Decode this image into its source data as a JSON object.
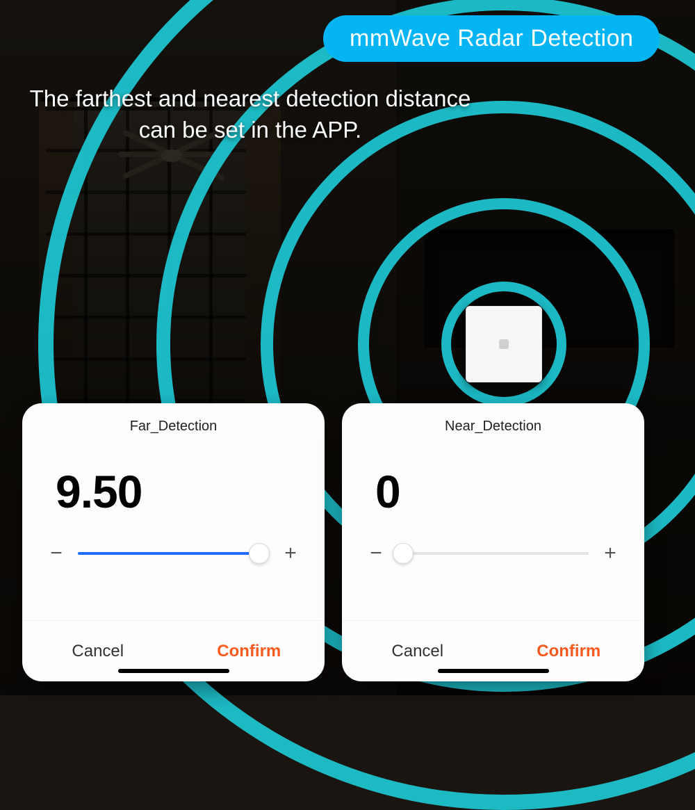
{
  "badge": "mmWave Radar Detection",
  "headline": "The farthest and nearest detection distance can be set in the APP.",
  "colors": {
    "accent": "#05B4F3",
    "ring": "#1EC3CF",
    "slider": "#1f6ef7",
    "confirm": "#f55a1e"
  },
  "cards": {
    "far": {
      "title": "Far_Detection",
      "value": "9.50",
      "slider_pct": 95,
      "minus": "−",
      "plus": "+",
      "cancel": "Cancel",
      "confirm": "Confirm"
    },
    "near": {
      "title": "Near_Detection",
      "value": "0",
      "slider_pct": 3,
      "minus": "−",
      "plus": "+",
      "cancel": "Cancel",
      "confirm": "Confirm"
    }
  }
}
